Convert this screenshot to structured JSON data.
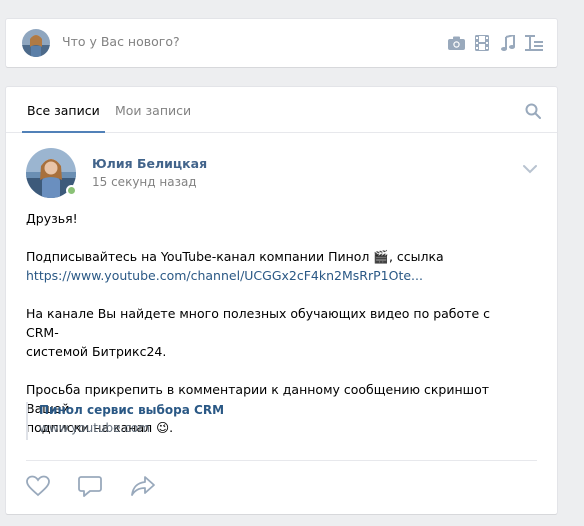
{
  "compose": {
    "placeholder": "Что у Вас нового?",
    "tools": [
      "camera-icon",
      "video-icon",
      "music-icon",
      "text-format-icon"
    ]
  },
  "tabs": [
    {
      "label": "Все записи",
      "active": true
    },
    {
      "label": "Мои записи",
      "active": false
    }
  ],
  "post": {
    "author": "Юлия Белицкая",
    "time": "15 секунд назад",
    "paragraphs": {
      "p1": "Друзья!",
      "p2_line1": "Подписывайтесь на YouTube-канал компании Пинол 🎬, ссылка",
      "p2_link": "https://www.youtube.com/channel/UCGGx2cF4kn2MsRrP1Ote...",
      "p3_line1": "На канале Вы найдете много полезных обучающих видео по работе с CRM-",
      "p3_line2": "системой Битрикс24.",
      "p4_line1": "Просьба прикрепить в комментарии к данному сообщению скриншот Вашей",
      "p4_line2": "подписки на канал 😉."
    },
    "attachment": {
      "title": "Пинол сервис выбора CRM",
      "url": "www.youtube.com"
    }
  },
  "colors": {
    "accent": "#5181b8",
    "author": "#42648b",
    "link": "#2a5885",
    "online": "#8ac176"
  }
}
